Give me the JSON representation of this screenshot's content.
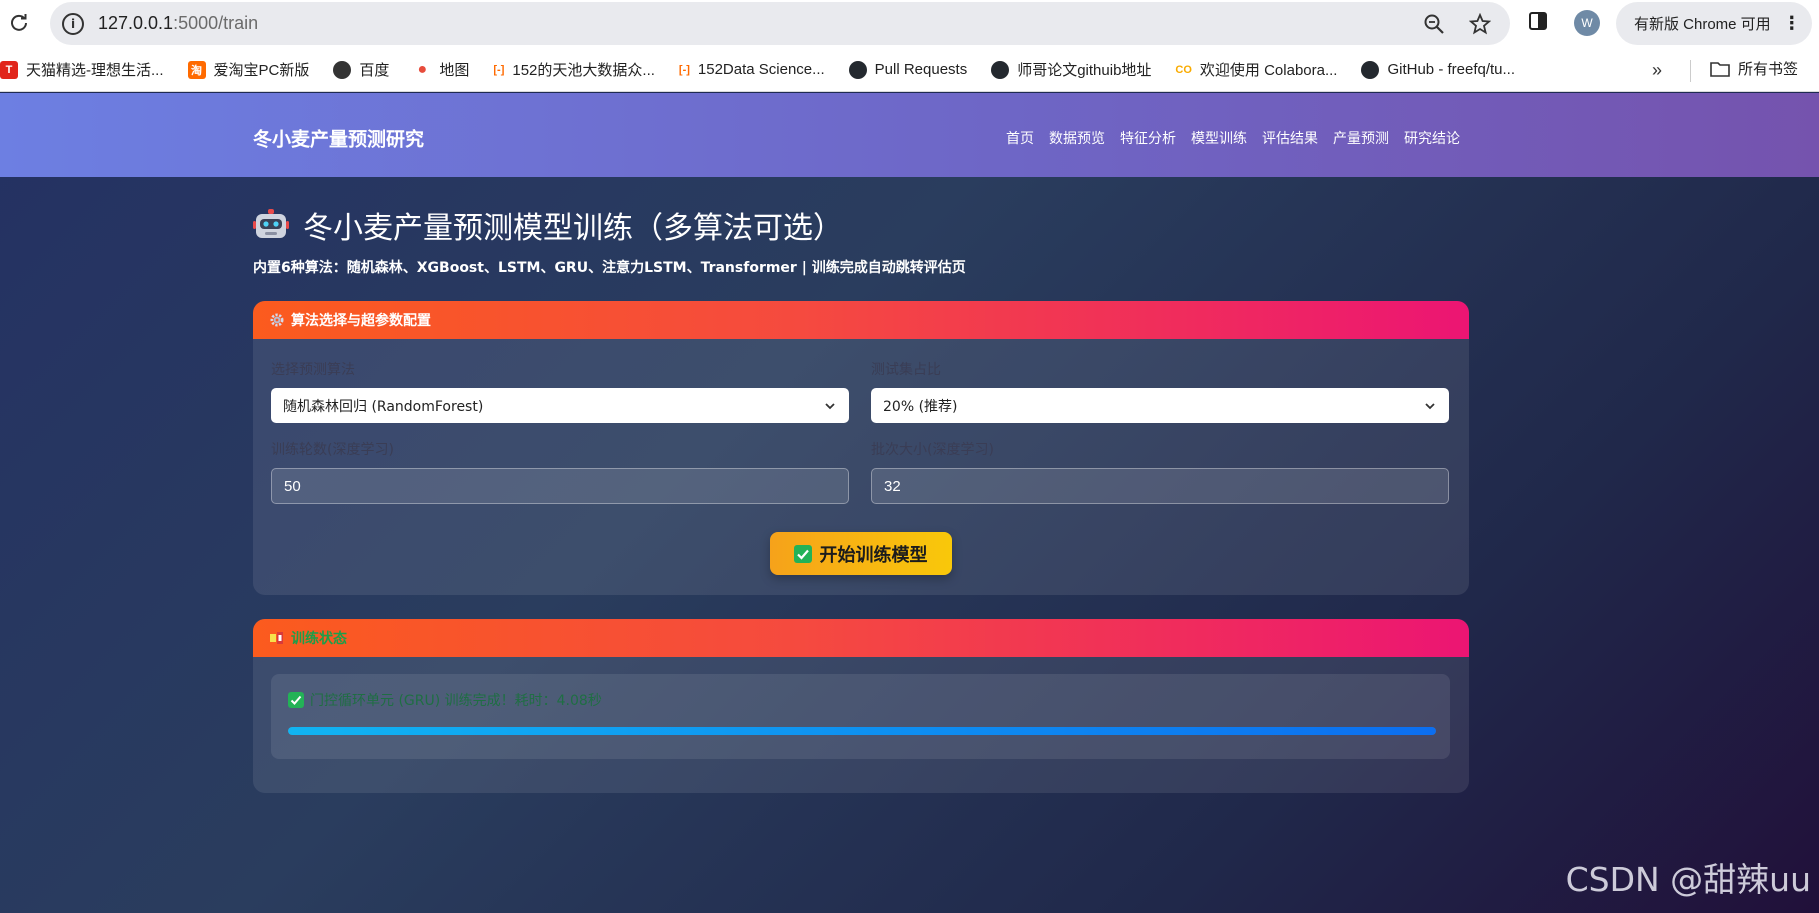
{
  "browser": {
    "url_host": "127.0.0.1",
    "url_path": ":5000/train",
    "update_label": "有新版 Chrome 可用",
    "avatar_letter": "W",
    "bookmarks": [
      {
        "label": "天猫精选-理想生活...",
        "icon": "tmall-icon",
        "color": "#e1251b",
        "glyph": "T"
      },
      {
        "label": "爱淘宝PC新版",
        "icon": "taobao-icon",
        "color": "#ff6a00",
        "glyph": "淘"
      },
      {
        "label": "百度",
        "icon": "globe-icon",
        "color": "#333333",
        "glyph": "◉"
      },
      {
        "label": "地图",
        "icon": "maps-pin-icon",
        "color": "#34a853",
        "glyph": "●"
      },
      {
        "label": "152的天池大数据众...",
        "icon": "tianchi-icon",
        "color": "#ff6a00",
        "glyph": "[-]"
      },
      {
        "label": "152Data Science...",
        "icon": "tianchi-icon",
        "color": "#ff6a00",
        "glyph": "[-]"
      },
      {
        "label": "Pull Requests",
        "icon": "github-icon",
        "color": "#24292f",
        "glyph": "●"
      },
      {
        "label": "师哥论文githuib地址",
        "icon": "github-icon",
        "color": "#24292f",
        "glyph": "●"
      },
      {
        "label": "欢迎使用 Colabora...",
        "icon": "colab-icon",
        "color": "#f9ab00",
        "glyph": "CO"
      },
      {
        "label": "GitHub - freefq/tu...",
        "icon": "github-icon",
        "color": "#24292f",
        "glyph": "●"
      }
    ],
    "all_bookmarks_label": "所有书签"
  },
  "navbar": {
    "brand": "冬小麦产量预测研究",
    "links": [
      "首页",
      "数据预览",
      "特征分析",
      "模型训练",
      "评估结果",
      "产量预测",
      "研究结论"
    ]
  },
  "header": {
    "title": "冬小麦产量预测模型训练（多算法可选）",
    "subtitle": "内置6种算法：随机森林、XGBoost、LSTM、GRU、注意力LSTM、Transformer | 训练完成自动跳转评估页"
  },
  "config_card": {
    "title": "算法选择与超参数配置",
    "algorithm_label": "选择预测算法",
    "algorithm_value": "随机森林回归 (RandomForest)",
    "test_ratio_label": "测试集占比",
    "test_ratio_value": "20% (推荐)",
    "epochs_label": "训练轮数(深度学习)",
    "epochs_value": "50",
    "batch_label": "批次大小(深度学习)",
    "batch_value": "32",
    "train_button": "开始训练模型"
  },
  "status_card": {
    "title": "训练状态",
    "message": "门控循环单元 (GRU) 训练完成！耗时：4.08秒",
    "progress_percent": 100
  },
  "watermark": "CSDN @甜辣uu",
  "colors": {
    "navbar_start": "#6d7fe2",
    "navbar_end": "#7553ae",
    "card_header_start": "#fb5b1e",
    "card_header_end": "#ec1573",
    "button": "#f6a21a",
    "progress": "#11b4f2",
    "success": "#1d9e4a"
  }
}
